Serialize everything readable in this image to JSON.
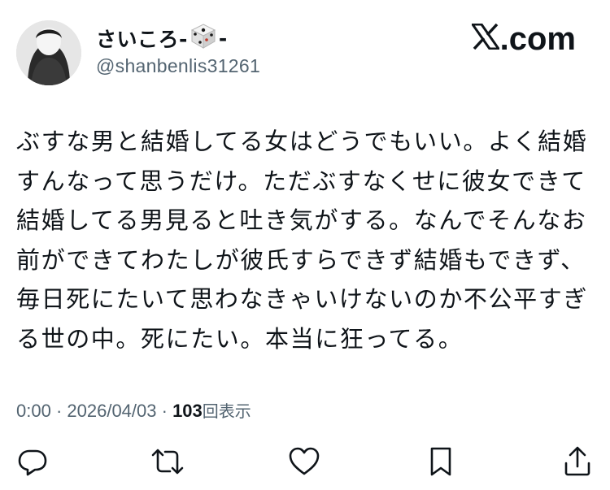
{
  "user": {
    "display_name_prefix": "さいころ-",
    "display_name_suffix": "-",
    "display_name_emoji": "die-icon",
    "handle": "@shanbenlis31261"
  },
  "brand": {
    "logo": "x-logo-icon",
    "text": ".com"
  },
  "tweet": {
    "lines": [
      "ぶすな男と結婚してる女はどうでもいい。よく結婚",
      "すんなって思うだけ。ただぶすなくせに彼女できて",
      "結婚してる男見ると吐き気がする。なんでそんなお",
      "前ができてわたしが彼氏すらできず結婚もできず、",
      "毎日死にたいて思わなきゃいけないのか不公平すぎ",
      "る世の中。死にたい。本当に狂ってる。"
    ]
  },
  "meta": {
    "time": "0:00",
    "separator": " · ",
    "date": "2026/04/03",
    "views_count": "103",
    "views_label": "回表示"
  },
  "actions": [
    {
      "name": "reply",
      "icon": "reply-icon"
    },
    {
      "name": "retweet",
      "icon": "retweet-icon"
    },
    {
      "name": "like",
      "icon": "heart-icon"
    },
    {
      "name": "bookmark",
      "icon": "bookmark-icon"
    },
    {
      "name": "share",
      "icon": "share-icon"
    }
  ],
  "colors": {
    "text": "#0f1419",
    "secondary": "#536471",
    "background": "#ffffff"
  }
}
